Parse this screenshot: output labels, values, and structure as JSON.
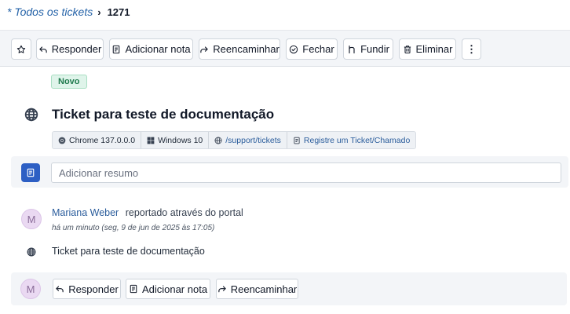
{
  "breadcrumb": {
    "parent": "* Todos os tickets",
    "separator": "›",
    "current": "1271"
  },
  "toolbar": {
    "reply": "Responder",
    "add_note": "Adicionar nota",
    "forward": "Reencaminhar",
    "close": "Fechar",
    "merge": "Fundir",
    "delete": "Eliminar",
    "more": "⋮"
  },
  "ticket": {
    "status": "Novo",
    "title": "Ticket para teste de documentação",
    "meta": {
      "browser": "Chrome 137.0.0.0",
      "os": "Windows 10",
      "path": "/support/tickets",
      "form": "Registre um Ticket/Chamado"
    }
  },
  "summary": {
    "placeholder": "Adicionar resumo"
  },
  "activity": {
    "avatar_initial": "M",
    "author": "Mariana Weber",
    "via": "reportado através do portal",
    "timestamp": "há um minuto (seg, 9 de jun de 2025 às 17:05)",
    "message": "Ticket para teste de documentação"
  },
  "reply_bar": {
    "avatar_initial": "M",
    "reply": "Responder",
    "add_note": "Adicionar nota",
    "forward": "Reencaminhar"
  },
  "colors": {
    "accent": "#2d5fc4",
    "link": "#2b5d9c",
    "status_bg": "#dff4ea",
    "status_text": "#1f7a4d"
  },
  "icons": [
    "star-icon",
    "reply-icon",
    "note-icon",
    "forward-icon",
    "check-circle-icon",
    "merge-icon",
    "trash-icon",
    "more-vertical-icon",
    "globe-icon",
    "chrome-icon",
    "windows-icon",
    "form-icon",
    "summary-icon"
  ]
}
